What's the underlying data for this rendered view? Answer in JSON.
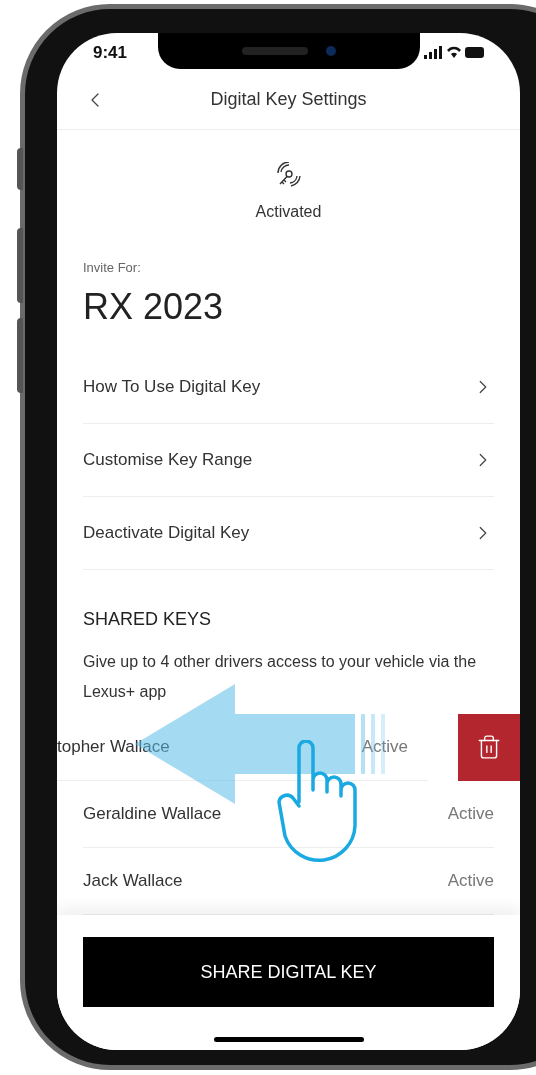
{
  "status_bar": {
    "time": "9:41"
  },
  "header": {
    "title": "Digital Key Settings"
  },
  "key_status": {
    "label": "Activated"
  },
  "vehicle": {
    "caption": "Invite For:",
    "name": "RX 2023"
  },
  "menu": [
    {
      "label": "How To Use Digital Key"
    },
    {
      "label": "Customise Key Range"
    },
    {
      "label": "Deactivate Digital Key"
    }
  ],
  "shared_keys": {
    "heading": "SHARED KEYS",
    "description": "Give up to 4 other drivers access to your vehicle via the Lexus+ app",
    "keys": [
      {
        "name": "topher Wallace",
        "status": "Active",
        "swiped": true
      },
      {
        "name": "Geraldine Wallace",
        "status": "Active",
        "swiped": false
      },
      {
        "name": "Jack Wallace",
        "status": "Active",
        "swiped": false
      }
    ]
  },
  "action_button": {
    "label": "SHARE DIGITAL KEY"
  }
}
